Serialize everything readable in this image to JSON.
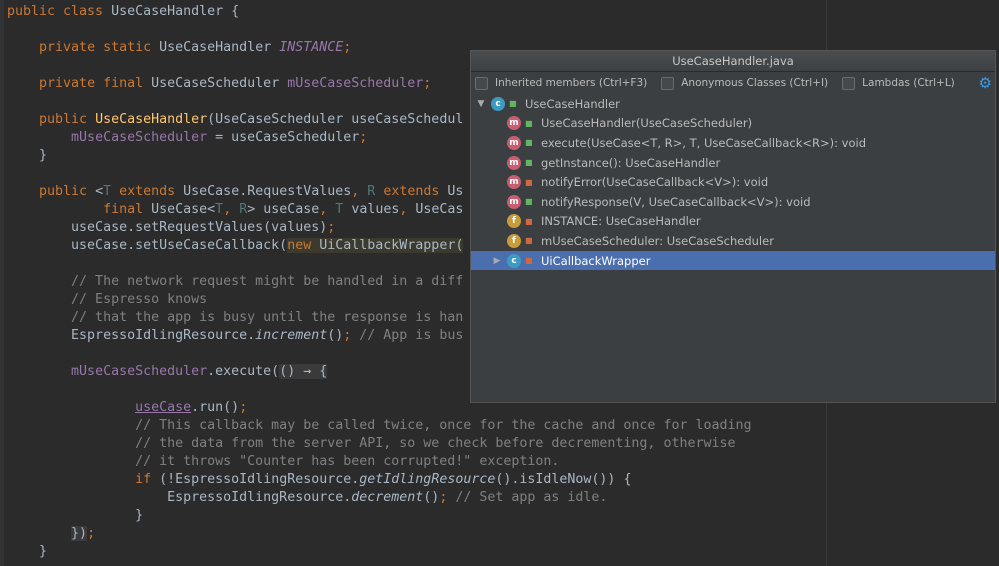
{
  "editor": {
    "lines": [
      {
        "n": 0,
        "tokens": [
          [
            "k",
            "public class "
          ],
          [
            "p",
            "UseCaseHandler {"
          ]
        ]
      },
      {
        "n": 2,
        "tokens": [
          [
            "p",
            "    "
          ],
          [
            "k",
            "private static "
          ],
          [
            "p",
            "UseCaseHandler "
          ],
          [
            "fi",
            "INSTANCE"
          ],
          [
            "k",
            ";"
          ]
        ]
      },
      {
        "n": 4,
        "tokens": [
          [
            "p",
            "    "
          ],
          [
            "k",
            "private final "
          ],
          [
            "p",
            "UseCaseScheduler "
          ],
          [
            "f",
            "mUseCaseScheduler"
          ],
          [
            "k",
            ";"
          ]
        ]
      },
      {
        "n": 6,
        "tokens": [
          [
            "p",
            "    "
          ],
          [
            "k",
            "public "
          ],
          [
            "m",
            "UseCaseHandler"
          ],
          [
            "p",
            "(UseCaseScheduler useCaseSchedul"
          ]
        ]
      },
      {
        "n": 7,
        "tokens": [
          [
            "p",
            "        "
          ],
          [
            "f",
            "mUseCaseScheduler"
          ],
          [
            "p",
            " = useCaseScheduler"
          ],
          [
            "k",
            ";"
          ]
        ]
      },
      {
        "n": 8,
        "tokens": [
          [
            "p",
            "    }"
          ]
        ]
      },
      {
        "n": 10,
        "tokens": [
          [
            "p",
            "    "
          ],
          [
            "k",
            "public "
          ],
          [
            "p",
            "<"
          ],
          [
            "t",
            "T "
          ],
          [
            "k",
            "extends "
          ],
          [
            "p",
            "UseCase.RequestValues"
          ],
          [
            "k",
            ", "
          ],
          [
            "t",
            "R"
          ],
          [
            "k",
            " extends "
          ],
          [
            "p",
            "Us"
          ]
        ]
      },
      {
        "n": 11,
        "tokens": [
          [
            "p",
            "            "
          ],
          [
            "k",
            "final "
          ],
          [
            "p",
            "UseCase<"
          ],
          [
            "t",
            "T"
          ],
          [
            "k",
            ", "
          ],
          [
            "t",
            "R"
          ],
          [
            "p",
            "> useCase"
          ],
          [
            "k",
            ", "
          ],
          [
            "t",
            "T"
          ],
          [
            "p",
            " values"
          ],
          [
            "k",
            ", "
          ],
          [
            "p",
            "UseCas"
          ]
        ]
      },
      {
        "n": 12,
        "tokens": [
          [
            "p",
            "        useCase.setRequestValues(values)"
          ],
          [
            "k",
            ";"
          ]
        ]
      },
      {
        "n": 13,
        "tokens": [
          [
            "p",
            "        useCase.setUseCaseCallback("
          ],
          [
            "h k",
            "new "
          ],
          [
            "h p",
            "UiCallbackWrapper("
          ]
        ]
      },
      {
        "n": 15,
        "tokens": [
          [
            "c",
            "        // The network request might be handled in a diff"
          ]
        ]
      },
      {
        "n": 16,
        "tokens": [
          [
            "c",
            "        // Espresso knows"
          ]
        ]
      },
      {
        "n": 17,
        "tokens": [
          [
            "c",
            "        // that the app is busy until the response is han"
          ]
        ]
      },
      {
        "n": 18,
        "tokens": [
          [
            "p",
            "        EspressoIdlingResource."
          ],
          [
            "i",
            "increment"
          ],
          [
            "p",
            "()"
          ],
          [
            "k",
            ";"
          ],
          [
            "c",
            " // App is bus"
          ]
        ]
      },
      {
        "n": 20,
        "tokens": [
          [
            "p",
            "        "
          ],
          [
            "f",
            "mUseCaseScheduler"
          ],
          [
            "p",
            ".execute("
          ],
          [
            "g",
            "() → {"
          ]
        ]
      },
      {
        "n": 22,
        "tokens": [
          [
            "p",
            "                "
          ],
          [
            "u",
            "useCase"
          ],
          [
            "p",
            ".run()"
          ],
          [
            "k",
            ";"
          ]
        ]
      },
      {
        "n": 23,
        "tokens": [
          [
            "c",
            "                // This callback may be called twice, once for the cache and once for loading"
          ]
        ]
      },
      {
        "n": 24,
        "tokens": [
          [
            "c",
            "                // the data from the server API, so we check before decrementing, otherwise"
          ]
        ]
      },
      {
        "n": 25,
        "tokens": [
          [
            "c",
            "                // it throws \"Counter has been corrupted!\" exception."
          ]
        ]
      },
      {
        "n": 26,
        "tokens": [
          [
            "p",
            "                "
          ],
          [
            "k",
            "if "
          ],
          [
            "p",
            "(!EspressoIdlingResource."
          ],
          [
            "i",
            "getIdlingResource"
          ],
          [
            "p",
            "().isIdleNow()) {"
          ]
        ]
      },
      {
        "n": 27,
        "tokens": [
          [
            "p",
            "                    EspressoIdlingResource."
          ],
          [
            "i",
            "decrement"
          ],
          [
            "p",
            "()"
          ],
          [
            "k",
            ";"
          ],
          [
            "c",
            " // Set app as idle."
          ]
        ]
      },
      {
        "n": 28,
        "tokens": [
          [
            "p",
            "                }"
          ]
        ]
      },
      {
        "n": 29,
        "tokens": [
          [
            "p",
            "        "
          ],
          [
            "g",
            "})"
          ],
          [
            "k",
            ";"
          ]
        ]
      },
      {
        "n": 30,
        "tokens": [
          [
            "p",
            "    }"
          ]
        ]
      }
    ]
  },
  "structure_popup": {
    "title": "UseCaseHandler.java",
    "filters": [
      {
        "label": "Inherited members (Ctrl+F3)",
        "checked": false
      },
      {
        "label": "Anonymous Classes (Ctrl+I)",
        "checked": false
      },
      {
        "label": "Lambdas (Ctrl+L)",
        "checked": false
      }
    ],
    "gear_icon": "gear-icon",
    "tree": [
      {
        "label": "UseCaseHandler",
        "kind": "c",
        "visibility": "public",
        "level": 0,
        "arrow": "▼",
        "selected": false
      },
      {
        "label": "UseCaseHandler(UseCaseScheduler)",
        "kind": "m",
        "visibility": "public",
        "level": 1,
        "arrow": "",
        "selected": false
      },
      {
        "label": "execute(UseCase<T, R>, T, UseCaseCallback<R>): void",
        "kind": "m",
        "visibility": "public",
        "level": 1,
        "arrow": "",
        "selected": false
      },
      {
        "label": "getInstance(): UseCaseHandler",
        "kind": "m",
        "visibility": "public",
        "level": 1,
        "arrow": "",
        "selected": false
      },
      {
        "label": "notifyError(UseCaseCallback<V>): void",
        "kind": "m",
        "visibility": "private",
        "level": 1,
        "arrow": "",
        "selected": false
      },
      {
        "label": "notifyResponse(V, UseCaseCallback<V>): void",
        "kind": "m",
        "visibility": "public",
        "level": 1,
        "arrow": "",
        "selected": false
      },
      {
        "label": "INSTANCE: UseCaseHandler",
        "kind": "f",
        "visibility": "private",
        "level": 1,
        "arrow": "",
        "selected": false
      },
      {
        "label": "mUseCaseScheduler: UseCaseScheduler",
        "kind": "f",
        "visibility": "private",
        "level": 1,
        "arrow": "",
        "selected": false
      },
      {
        "label": "UiCallbackWrapper",
        "kind": "c",
        "visibility": "private",
        "level": 1,
        "arrow": "▶",
        "selected": true
      }
    ],
    "colors": {
      "selection": "#4b6eaf",
      "keyword": "#cc7832",
      "field": "#9876aa",
      "comment": "#808080"
    }
  }
}
